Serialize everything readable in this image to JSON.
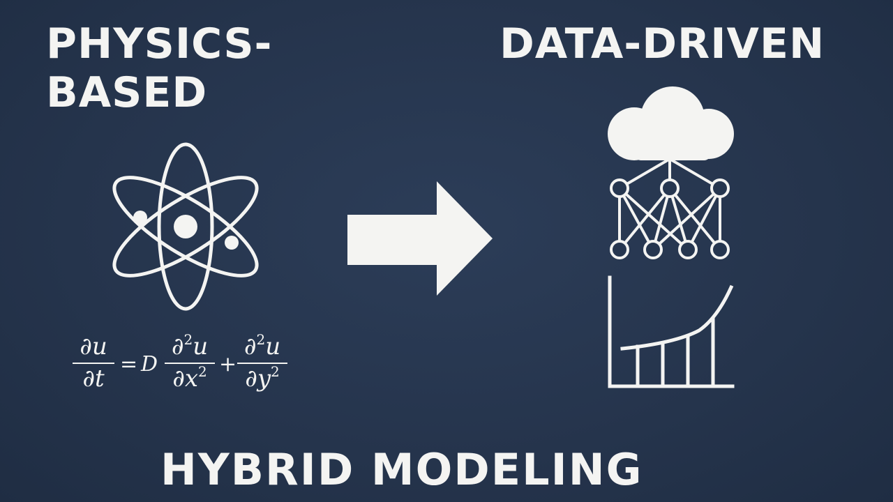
{
  "left_heading": {
    "line1": "PHYSICS-",
    "line2": "BASED"
  },
  "right_heading": "DATA-DRIVEN",
  "bottom_heading": "HYBRID MODELING",
  "equation": {
    "lhs_num": "∂u",
    "lhs_den": "∂t",
    "equals": "=",
    "coef": "D",
    "t1_num_a": "∂",
    "t1_num_sup": "2",
    "t1_num_b": "u",
    "t1_den_a": "∂x",
    "t1_den_sup": "2",
    "plus": "+",
    "t2_num_a": "∂",
    "t2_num_sup": "2",
    "t2_num_b": "u",
    "t2_den_a": "∂y",
    "t2_den_sup": "2"
  },
  "icons": [
    "atom-icon",
    "arrow-right-icon",
    "cloud-icon",
    "neural-network-icon",
    "growth-chart-icon"
  ],
  "colors": {
    "background": "#26364f",
    "foreground": "#f4f4f2"
  }
}
